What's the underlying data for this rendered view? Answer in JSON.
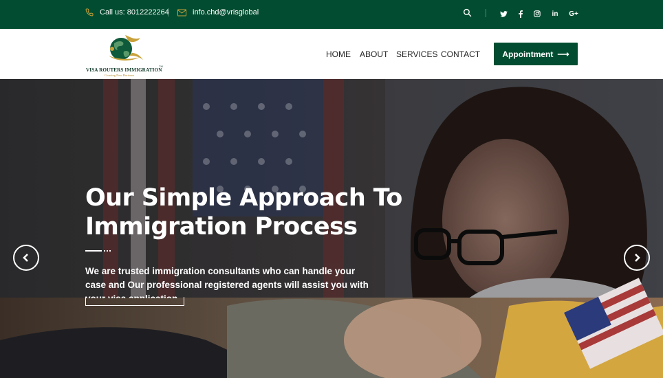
{
  "topbar": {
    "phone": "Call us: 8012222264",
    "email": "info.chd@vrisglobal",
    "icons": [
      "phone-icon",
      "envelope-icon",
      "search-icon"
    ],
    "social": [
      "twitter",
      "facebook",
      "instagram",
      "linkedin",
      "google-plus"
    ],
    "social_labels": [
      "t",
      "f",
      "◎",
      "in",
      "G+"
    ]
  },
  "logo": {
    "brand": "VISA ROUTERS IMMIGRATION",
    "tm": "TM",
    "tagline": "Crossing New Horizons"
  },
  "nav": {
    "home": "HOME",
    "about": "ABOUT",
    "services": "SERVICES",
    "contact": "CONTACT",
    "appointment": "Appointment",
    "appointment_arrow": "⟶"
  },
  "hero": {
    "title_line1": "Our Simple Approach To",
    "title_line2": "Immigration Process",
    "text": "We are trusted immigration consultants who can handle your case and Our professional registered agents will assist you with your visa application"
  },
  "colors": {
    "brand_green": "#024d31",
    "gold": "#c9a13b"
  }
}
